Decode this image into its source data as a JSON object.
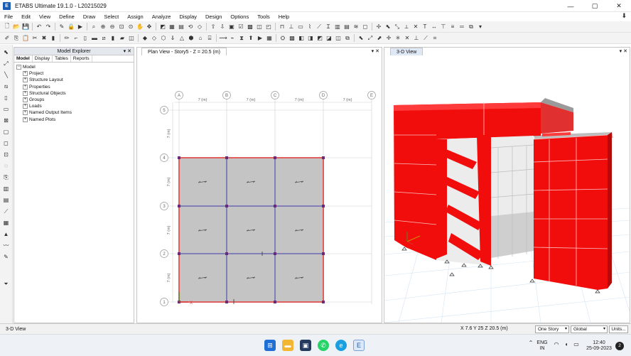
{
  "window": {
    "title": "ETABS Ultimate 19.1.0 - L20215029",
    "app_icon": "E",
    "controls": [
      "—",
      "▢",
      "✕"
    ]
  },
  "menu": [
    "File",
    "Edit",
    "View",
    "Define",
    "Draw",
    "Select",
    "Assign",
    "Analyze",
    "Display",
    "Design",
    "Options",
    "Tools",
    "Help"
  ],
  "explorer": {
    "title": "Model Explorer",
    "tabs": [
      "Model",
      "Display",
      "Tables",
      "Reports"
    ],
    "tree_root": "Model",
    "tree_items": [
      "Project",
      "Structure Layout",
      "Properties",
      "Structural Objects",
      "Groups",
      "Loads",
      "Named Output Items",
      "Named Plots"
    ]
  },
  "plan_view": {
    "tab_title": "Plan View - Story5 - Z = 20.5 (m)",
    "column_labels": [
      "A",
      "B",
      "C",
      "D",
      "E"
    ],
    "row_labels": [
      "1",
      "2",
      "3",
      "4",
      "5"
    ],
    "bay_dim": "7 (m)",
    "slab_color": "#c4c4c4",
    "beam_color": "#3b3ba8",
    "edge_color": "#e06060"
  },
  "model_view": {
    "tab_title": "3-D View",
    "wall_color": "#f20d0d",
    "floor_color": "#bdbdbd"
  },
  "status": {
    "view_label": "3-D View",
    "coords": "X 7.6  Y 25  Z 20.5 (m)",
    "story_option": "One Story",
    "coord_system": "Global",
    "units_button": "Units..."
  },
  "taskbar": {
    "language": "ENG",
    "region": "IN",
    "time": "12:40",
    "date": "25-09-2023",
    "notification_count": "2"
  }
}
